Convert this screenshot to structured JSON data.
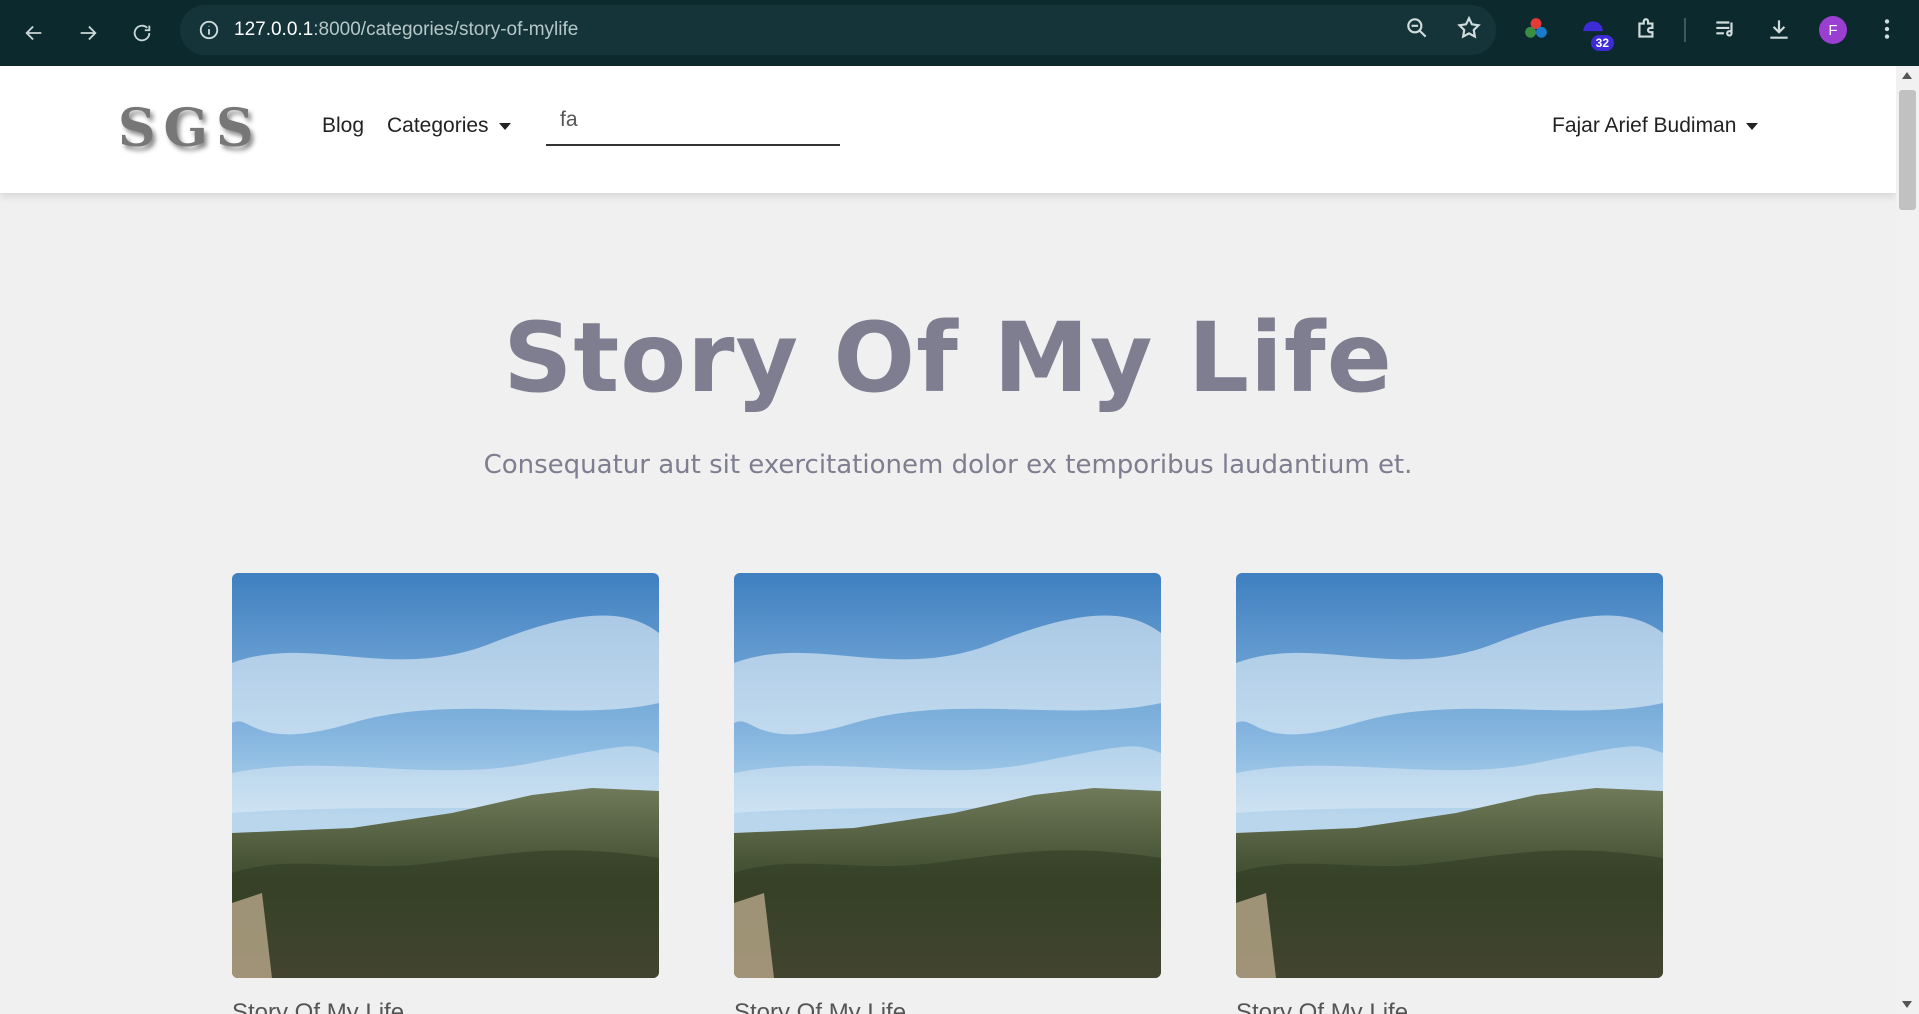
{
  "browser": {
    "url_host": "127.0.0.1",
    "url_path": ":8000/categories/story-of-mylife",
    "extension_badge": "32",
    "profile_initial": "F"
  },
  "navbar": {
    "logo": "SGS",
    "blog_label": "Blog",
    "categories_label": "Categories",
    "search_value": "fa",
    "user_name": "Fajar Arief Budiman"
  },
  "hero": {
    "title": "Story Of My Life",
    "subtitle": "Consequatur aut sit exercitationem dolor ex temporibus laudantium et."
  },
  "posts": [
    {
      "title": "Story Of My Life"
    },
    {
      "title": "Story Of My Life"
    },
    {
      "title": "Story Of My Life"
    }
  ],
  "colors": {
    "chrome_bg": "#0c2a2e",
    "page_bg": "#f0f0f0",
    "hero_text": "#7e7e90"
  }
}
